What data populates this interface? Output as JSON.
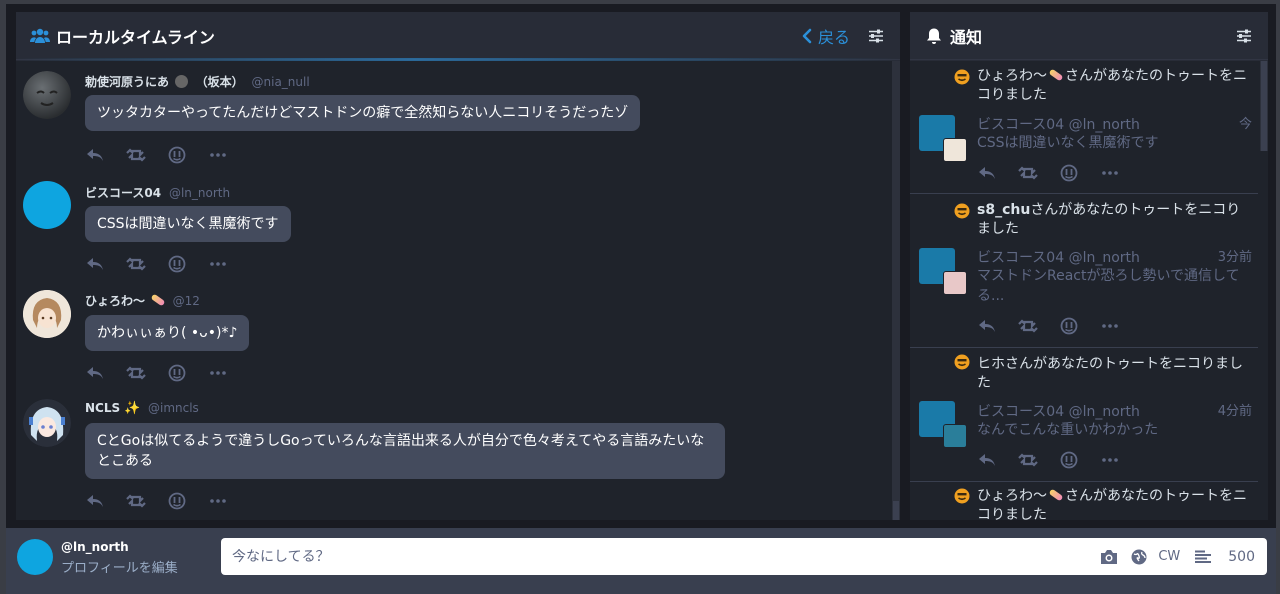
{
  "local_column": {
    "title": "ローカルタイムライン",
    "back_label": "戻る",
    "statuses": [
      {
        "display_name": "勅使河原うにあ",
        "suffix": "（坂本）",
        "acct": "@nia_null",
        "content": "ツッタカターやってたんだけどマストドンの癖で全然知らない人ニコリそうだったゾ"
      },
      {
        "display_name": "ビスコース04",
        "suffix": "",
        "acct": "@ln_north",
        "content": "CSSは間違いなく黒魔術です"
      },
      {
        "display_name": "ひょろわ〜",
        "suffix": "",
        "acct": "@12",
        "content": "かわぃぃぁり( •ᴗ•)*♪"
      },
      {
        "display_name": "NCLS",
        "suffix": "",
        "acct": "@imncls",
        "content": "CとGoは似てるようで違うしGoっていろんな言語出来る人が自分で色々考えてやる言語みたいなとこある"
      }
    ]
  },
  "notifications_column": {
    "title": "通知",
    "items": [
      {
        "actor": "ひょろわ〜",
        "text": "さんがあなたのトゥートをニコりました",
        "status_name": "ビスコース04 @ln_north",
        "time": "今",
        "status_text": "CSSは間違いなく黒魔術です"
      },
      {
        "actor": "s8_chu",
        "text": "さんがあなたのトゥートをニコりました",
        "status_name": "ビスコース04 @ln_north",
        "time": "3分前",
        "status_text": "マストドンReactが恐ろし勢いで通信してる..."
      },
      {
        "actor": "ヒホ",
        "text": "さんがあなたのトゥートをニコりました",
        "status_name": "ビスコース04 @ln_north",
        "time": "4分前",
        "status_text": "なんでこんな重いかわかった"
      },
      {
        "actor": "ひょろわ〜",
        "text": "さんがあなたのトゥートをニコりました",
        "status_name": "",
        "time": "",
        "status_text": ""
      }
    ]
  },
  "footer": {
    "username": "@ln_north",
    "edit_profile": "プロフィールを編集",
    "placeholder": "今なにしてる？",
    "cw_label": "CW",
    "char_count": "500"
  },
  "colors": {
    "accent": "#2b90d9",
    "nico": "#f0a020"
  },
  "icons": [
    "users-icon",
    "chevron-left-icon",
    "sliders-icon",
    "bell-icon",
    "reply-icon",
    "boost-icon",
    "nico-icon",
    "more-icon",
    "camera-icon",
    "globe-icon",
    "align-icon"
  ]
}
